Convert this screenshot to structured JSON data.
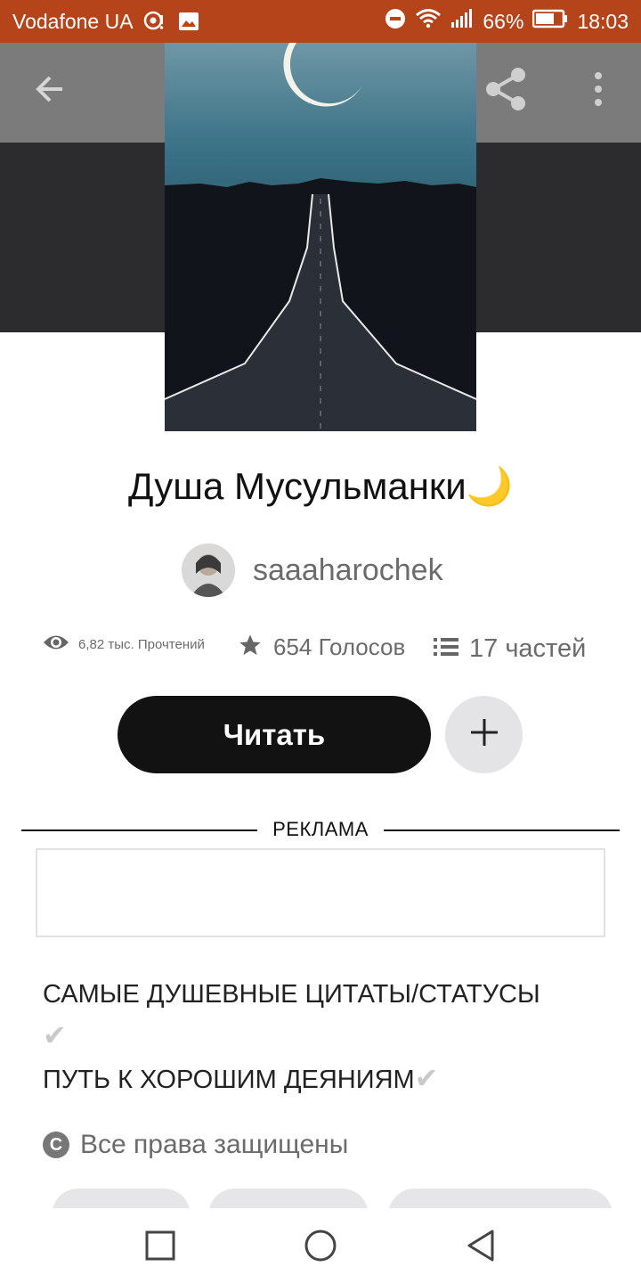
{
  "status_bar": {
    "carrier": "Vodafone UA",
    "battery": "66%",
    "time": "18:03",
    "icons": [
      "location-pin-icon",
      "image-icon",
      "dnd-icon",
      "wifi-icon",
      "signal-icon",
      "battery-icon"
    ]
  },
  "toolbar": {
    "icons": [
      "back-arrow-icon",
      "share-icon",
      "more-vert-icon"
    ]
  },
  "story": {
    "title": "Душа Мусульманки",
    "title_emoji": "🌙",
    "author": "saaaharochek",
    "stats": {
      "reads": "6,82 тыс. Прочтений",
      "votes": "654 Голосов",
      "parts": "17 частей"
    },
    "read_button": "Читать",
    "ad_label": "РЕКЛАМА",
    "description": {
      "line1": "САМЫЕ ДУШЕВНЫЕ ЦИТАТЫ/СТАТУСЫ",
      "line2": "ПУТЬ К ХОРОШИМ ДЕЯНИЯМ",
      "check": "✔"
    },
    "copyright": "Все права защищены"
  },
  "nav_bar": {
    "icons": [
      "recent-apps-icon",
      "home-icon",
      "back-icon"
    ]
  },
  "colors": {
    "status_bar": "#b5441a",
    "header_band": "#2c2c2e",
    "read_button": "#121212",
    "add_button": "#e4e4e6",
    "muted_text": "#6b6b6b"
  }
}
